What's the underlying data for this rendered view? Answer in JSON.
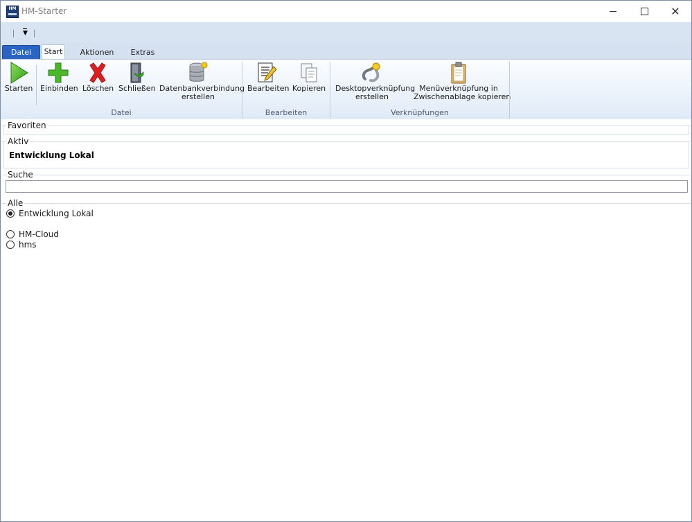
{
  "window": {
    "title": "HM-Starter",
    "app_icon_text": "HM"
  },
  "ribbon": {
    "tabs": [
      {
        "label": "Datei"
      },
      {
        "label": "Start"
      },
      {
        "label": "Aktionen"
      },
      {
        "label": "Extras"
      }
    ],
    "groups": {
      "datei": {
        "label": "Datei",
        "buttons": {
          "starten": "Starten",
          "einbinden": "Einbinden",
          "loeschen": "Löschen",
          "schliessen": "Schließen",
          "db_line1": "Datenbankverbindung",
          "db_line2": "erstellen"
        }
      },
      "bearbeiten": {
        "label": "Bearbeiten",
        "buttons": {
          "bearbeiten": "Bearbeiten",
          "kopieren": "Kopieren"
        }
      },
      "verknuepfungen": {
        "label": "Verknüpfungen",
        "buttons": {
          "desktop_line1": "Desktopverknüpfung",
          "desktop_line2": "erstellen",
          "menu_line1": "Menüverknüpfung in",
          "menu_line2": "Zwischenablage kopieren"
        }
      }
    }
  },
  "sections": {
    "favoriten": {
      "label": "Favoriten"
    },
    "aktiv": {
      "label": "Aktiv",
      "value": "Entwicklung Lokal"
    },
    "suche": {
      "label": "Suche",
      "value": ""
    },
    "alle": {
      "label": "Alle",
      "items": [
        {
          "label": "Entwicklung Lokal",
          "selected": true
        },
        {
          "label": "HM-Cloud",
          "selected": false
        },
        {
          "label": "hms",
          "selected": false
        }
      ]
    }
  }
}
